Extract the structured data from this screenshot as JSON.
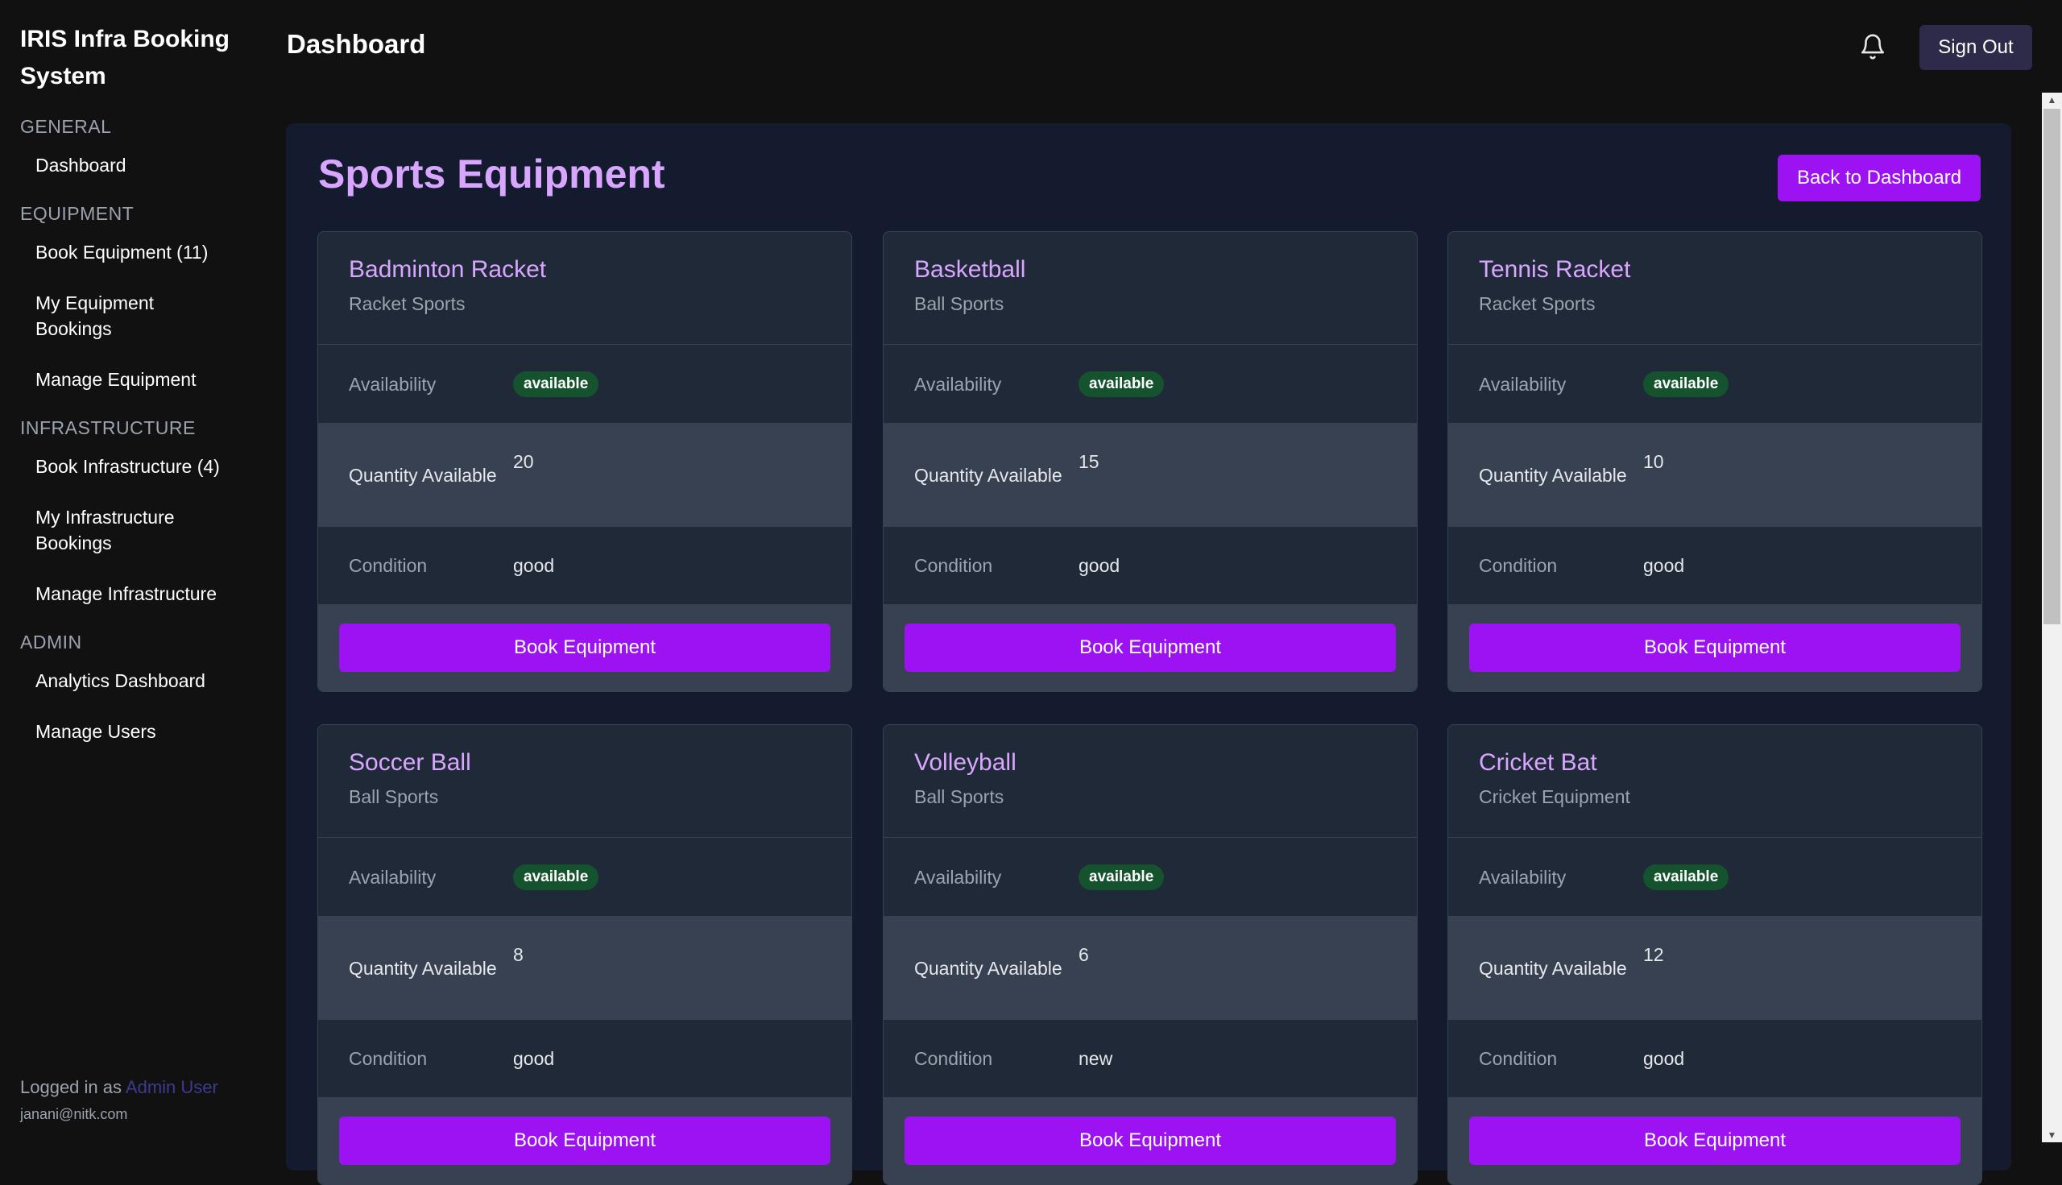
{
  "app": {
    "title": "IRIS Infra Booking System"
  },
  "sidebar": {
    "sections": [
      {
        "label": "GENERAL",
        "items": [
          "Dashboard"
        ]
      },
      {
        "label": "EQUIPMENT",
        "items": [
          "Book Equipment (11)",
          "My Equipment Bookings",
          "Manage Equipment"
        ]
      },
      {
        "label": "INFRASTRUCTURE",
        "items": [
          "Book Infrastructure (4)",
          "My Infrastructure Bookings",
          "Manage Infrastructure"
        ]
      },
      {
        "label": "ADMIN",
        "items": [
          "Analytics Dashboard",
          "Manage Users"
        ]
      }
    ],
    "footer": {
      "logged_in_prefix": "Logged in as",
      "user_name": "Admin User",
      "email": "janani@nitk.com"
    }
  },
  "header": {
    "title": "Dashboard",
    "bell_icon": "bell-icon",
    "sign_out_label": "Sign Out"
  },
  "main": {
    "title": "Sports Equipment",
    "back_label": "Back to Dashboard",
    "labels": {
      "availability": "Availability",
      "quantity": "Quantity Available",
      "condition": "Condition",
      "book": "Book Equipment"
    },
    "cards": [
      {
        "name": "Badminton Racket",
        "category": "Racket Sports",
        "availability": "available",
        "quantity": "20",
        "condition": "good"
      },
      {
        "name": "Basketball",
        "category": "Ball Sports",
        "availability": "available",
        "quantity": "15",
        "condition": "good"
      },
      {
        "name": "Tennis Racket",
        "category": "Racket Sports",
        "availability": "available",
        "quantity": "10",
        "condition": "good"
      },
      {
        "name": "Soccer Ball",
        "category": "Ball Sports",
        "availability": "available",
        "quantity": "8",
        "condition": "good"
      },
      {
        "name": "Volleyball",
        "category": "Ball Sports",
        "availability": "available",
        "quantity": "6",
        "condition": "new"
      },
      {
        "name": "Cricket Bat",
        "category": "Cricket Equipment",
        "availability": "available",
        "quantity": "12",
        "condition": "good"
      }
    ]
  },
  "colors": {
    "accent": "#9c12f2",
    "title": "#d9a6ff",
    "badge": "#14532d"
  }
}
